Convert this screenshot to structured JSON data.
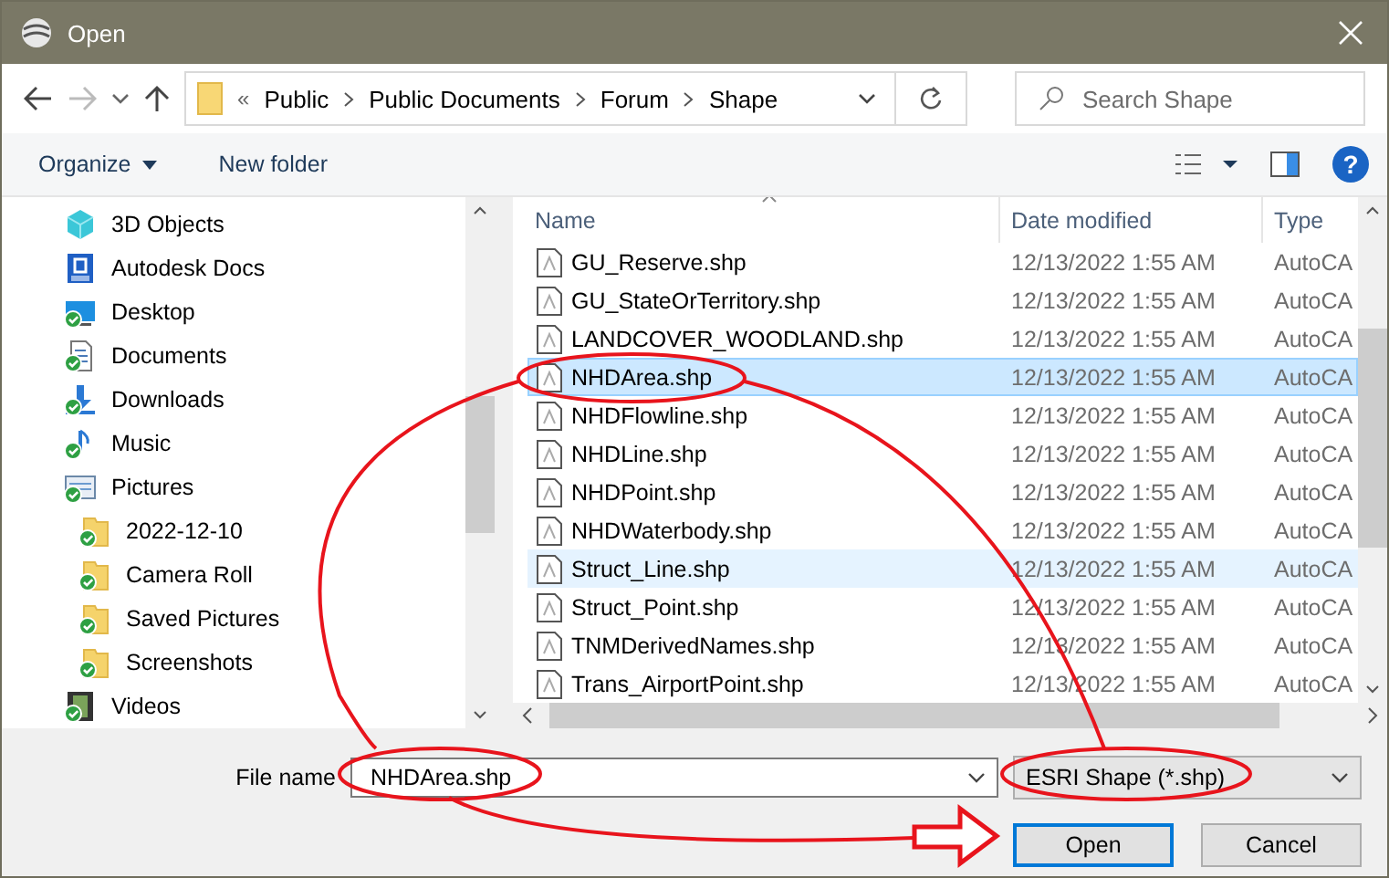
{
  "window": {
    "title": "Open"
  },
  "address": {
    "breadcrumb": [
      "Public",
      "Public Documents",
      "Forum",
      "Shape"
    ],
    "overflow": "«"
  },
  "search": {
    "placeholder": "Search Shape"
  },
  "toolbar": {
    "organize": "Organize",
    "new_folder": "New folder",
    "help": "?"
  },
  "sidebar": {
    "items": [
      {
        "label": "3D Objects",
        "kind": "cube",
        "synced": false
      },
      {
        "label": "Autodesk Docs",
        "kind": "docs",
        "synced": false
      },
      {
        "label": "Desktop",
        "kind": "desktop",
        "synced": true
      },
      {
        "label": "Documents",
        "kind": "documents",
        "synced": true
      },
      {
        "label": "Downloads",
        "kind": "downloads",
        "synced": true
      },
      {
        "label": "Music",
        "kind": "music",
        "synced": true
      },
      {
        "label": "Pictures",
        "kind": "pictures",
        "synced": true,
        "children": [
          {
            "label": "2022-12-10",
            "kind": "folder",
            "synced": true
          },
          {
            "label": "Camera Roll",
            "kind": "folder",
            "synced": true
          },
          {
            "label": "Saved Pictures",
            "kind": "folder",
            "synced": true
          },
          {
            "label": "Screenshots",
            "kind": "folder",
            "synced": true
          }
        ]
      },
      {
        "label": "Videos",
        "kind": "videos",
        "synced": true
      }
    ]
  },
  "file_list": {
    "columns": [
      "Name",
      "Date modified",
      "Type"
    ],
    "rows": [
      {
        "name": "GU_Reserve.shp",
        "date": "12/13/2022 1:55 AM",
        "type": "AutoCA",
        "selected": false,
        "hovered": false
      },
      {
        "name": "GU_StateOrTerritory.shp",
        "date": "12/13/2022 1:55 AM",
        "type": "AutoCA",
        "selected": false,
        "hovered": false
      },
      {
        "name": "LANDCOVER_WOODLAND.shp",
        "date": "12/13/2022 1:55 AM",
        "type": "AutoCA",
        "selected": false,
        "hovered": false
      },
      {
        "name": "NHDArea.shp",
        "date": "12/13/2022 1:55 AM",
        "type": "AutoCA",
        "selected": true,
        "hovered": false
      },
      {
        "name": "NHDFlowline.shp",
        "date": "12/13/2022 1:55 AM",
        "type": "AutoCA",
        "selected": false,
        "hovered": false
      },
      {
        "name": "NHDLine.shp",
        "date": "12/13/2022 1:55 AM",
        "type": "AutoCA",
        "selected": false,
        "hovered": false
      },
      {
        "name": "NHDPoint.shp",
        "date": "12/13/2022 1:55 AM",
        "type": "AutoCA",
        "selected": false,
        "hovered": false
      },
      {
        "name": "NHDWaterbody.shp",
        "date": "12/13/2022 1:55 AM",
        "type": "AutoCA",
        "selected": false,
        "hovered": false
      },
      {
        "name": "Struct_Line.shp",
        "date": "12/13/2022 1:55 AM",
        "type": "AutoCA",
        "selected": false,
        "hovered": true
      },
      {
        "name": "Struct_Point.shp",
        "date": "12/13/2022 1:55 AM",
        "type": "AutoCA",
        "selected": false,
        "hovered": false
      },
      {
        "name": "TNMDerivedNames.shp",
        "date": "12/13/2022 1:55 AM",
        "type": "AutoCA",
        "selected": false,
        "hovered": false
      },
      {
        "name": "Trans_AirportPoint.shp",
        "date": "12/13/2022 1:55 AM",
        "type": "AutoCA",
        "selected": false,
        "hovered": false
      }
    ]
  },
  "file_name": {
    "label": "File name",
    "value": "NHDArea.shp"
  },
  "file_type": {
    "value": "ESRI Shape (*.shp)"
  },
  "buttons": [
    {
      "label": "Open",
      "default": true
    },
    {
      "label": "Cancel",
      "default": false
    }
  ]
}
